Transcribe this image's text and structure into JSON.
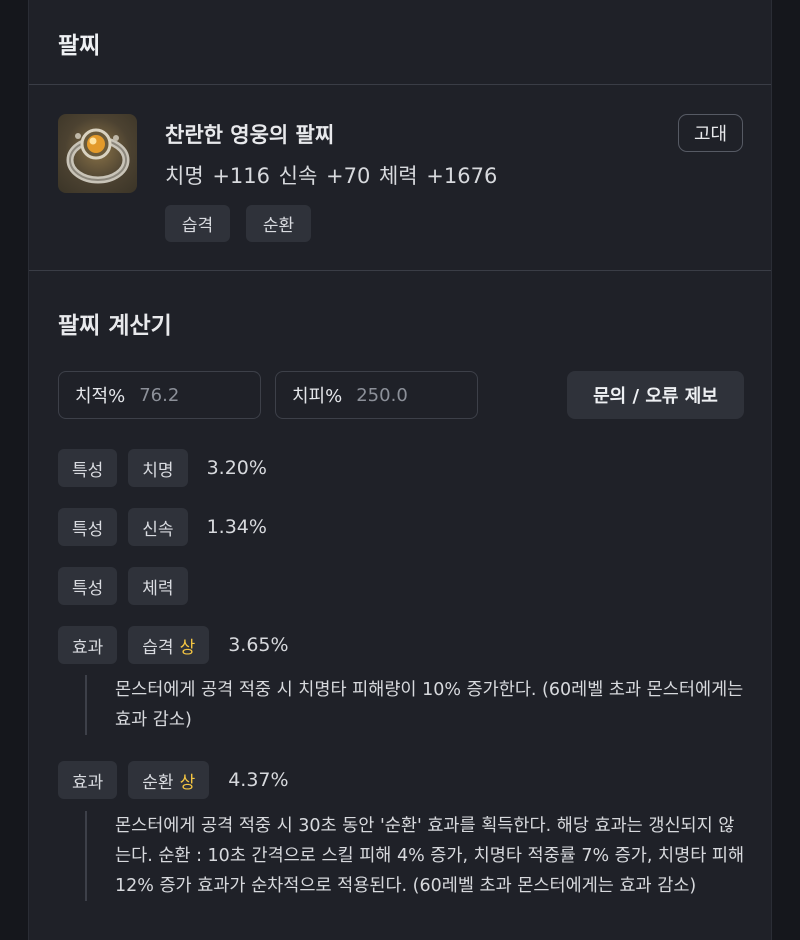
{
  "header": {
    "title": "팔찌"
  },
  "item": {
    "name": "찬란한 영웅의 팔찌",
    "stats": "치명 +116  신속 +70  체력 +1676",
    "grade": "고대",
    "tags": [
      "습격",
      "순환"
    ]
  },
  "calculator": {
    "title": "팔찌 계산기",
    "crit_rate": {
      "label": "치적%",
      "value": "76.2"
    },
    "crit_dmg": {
      "label": "치피%",
      "value": "250.0"
    },
    "report_button": "문의 / 오류 제보",
    "rows": [
      {
        "type": "특성",
        "name": "치명",
        "tier": "",
        "value": "3.20%"
      },
      {
        "type": "특성",
        "name": "신속",
        "tier": "",
        "value": "1.34%"
      },
      {
        "type": "특성",
        "name": "체력",
        "tier": "",
        "value": ""
      },
      {
        "type": "효과",
        "name": "습격",
        "tier": "상",
        "value": "3.65%",
        "description": "몬스터에게 공격 적중 시 치명타 피해량이 10% 증가한다. (60레벨 초과 몬스터에게는 효과 감소)"
      },
      {
        "type": "효과",
        "name": "순환",
        "tier": "상",
        "value": "4.37%",
        "description": "몬스터에게 공격 적중 시 30초 동안 '순환' 효과를 획득한다. 해당 효과는 갱신되지 않는다. 순환 : 10초 간격으로 스킬 피해 4% 증가, 치명타 적중률 7% 증가, 치명타 피해 12% 증가 효과가 순차적으로 적용된다. (60레벨 초과 몬스터에게는 효과 감소)"
      }
    ]
  },
  "colors": {
    "tier_high": "#f4c542",
    "background": "#1f2128"
  }
}
